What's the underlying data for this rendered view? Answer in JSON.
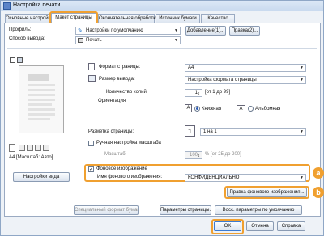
{
  "window": {
    "title": "Настройка печати"
  },
  "tabs": [
    {
      "label": "Основные настройки"
    },
    {
      "label": "Макет страницы"
    },
    {
      "label": "Окончательная обработка"
    },
    {
      "label": "Источник бумаги"
    },
    {
      "label": "Качество"
    }
  ],
  "profile": {
    "label": "Профиль:",
    "value": "Настройки по умолчанию",
    "add_label": "Добавление(1)...",
    "edit_label": "Правка(2)..."
  },
  "output_method": {
    "label": "Способ вывода:",
    "value": "Печать"
  },
  "page_size": {
    "label": "Формат страницы:",
    "value": "A4"
  },
  "output_size": {
    "label": "Размер вывода:",
    "value": "Настройка формата страницы"
  },
  "copies": {
    "label": "Количество копий:",
    "value": "1",
    "range": "[от 1 до 99]"
  },
  "orientation": {
    "label": "Ориентация",
    "portrait_label": "Книжная",
    "landscape_label": "Альбомная",
    "selected": "portrait"
  },
  "layout": {
    "label": "Разметка страницы:",
    "value": "1 на 1",
    "icon_value": "1"
  },
  "manual_scale": {
    "label": "Ручная настройка масштаба",
    "checked": false,
    "scale_label": "Масштаб:",
    "scale_value": "100",
    "scale_range": "% [от 25 до 200]"
  },
  "preview": {
    "caption": "A4 [Масштаб: Авто]",
    "view_settings_label": "Настройки вида"
  },
  "watermark": {
    "checkbox_label": "Фоновое изображение",
    "checked": true,
    "name_label": "Имя фонового изображения:",
    "name_value": "КОНФИДЕНЦИАЛЬНО",
    "edit_label": "Правка фонового изображения..."
  },
  "bottom_buttons": {
    "special_format": "Специальный формат бумаги...",
    "page_options": "Параметры страницы...",
    "restore_defaults": "Восс. параметры по умолчанию"
  },
  "dialog_buttons": {
    "ok": "OK",
    "cancel": "Отмена",
    "help": "Справка"
  },
  "callouts": {
    "a": "a",
    "b": "b"
  },
  "colors": {
    "highlight": "#f0a030",
    "accent": "#2a5bb8"
  }
}
